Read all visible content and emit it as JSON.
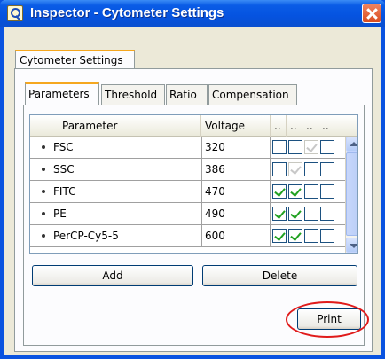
{
  "window": {
    "title": "Inspector - Cytometer Settings"
  },
  "outer_tab": {
    "label": "Cytometer Settings"
  },
  "tabs": [
    "Parameters",
    "Threshold",
    "Ratio",
    "Compensation"
  ],
  "grid": {
    "columns": [
      "Parameter",
      "Voltage",
      "..",
      "..",
      "..",
      ".."
    ],
    "rows": [
      {
        "parameter": "FSC",
        "voltage": "320",
        "checks": [
          false,
          false,
          true,
          false,
          false
        ]
      },
      {
        "parameter": "SSC",
        "voltage": "386",
        "checks": [
          false,
          true,
          false,
          false,
          false
        ]
      },
      {
        "parameter": "FITC",
        "voltage": "470",
        "checks": [
          true,
          true,
          false,
          false,
          false
        ]
      },
      {
        "parameter": "PE",
        "voltage": "490",
        "checks": [
          true,
          true,
          false,
          false,
          false
        ]
      },
      {
        "parameter": "PerCP-Cy5-5",
        "voltage": "600",
        "checks": [
          true,
          true,
          false,
          false,
          false
        ]
      }
    ]
  },
  "buttons": {
    "add": "Add",
    "delete": "Delete",
    "print": "Print"
  },
  "colors": {
    "titlebar": "#0553e0",
    "check": "#21a121",
    "highlight": "#e01b1b",
    "tab_accent": "#f5a71f"
  }
}
